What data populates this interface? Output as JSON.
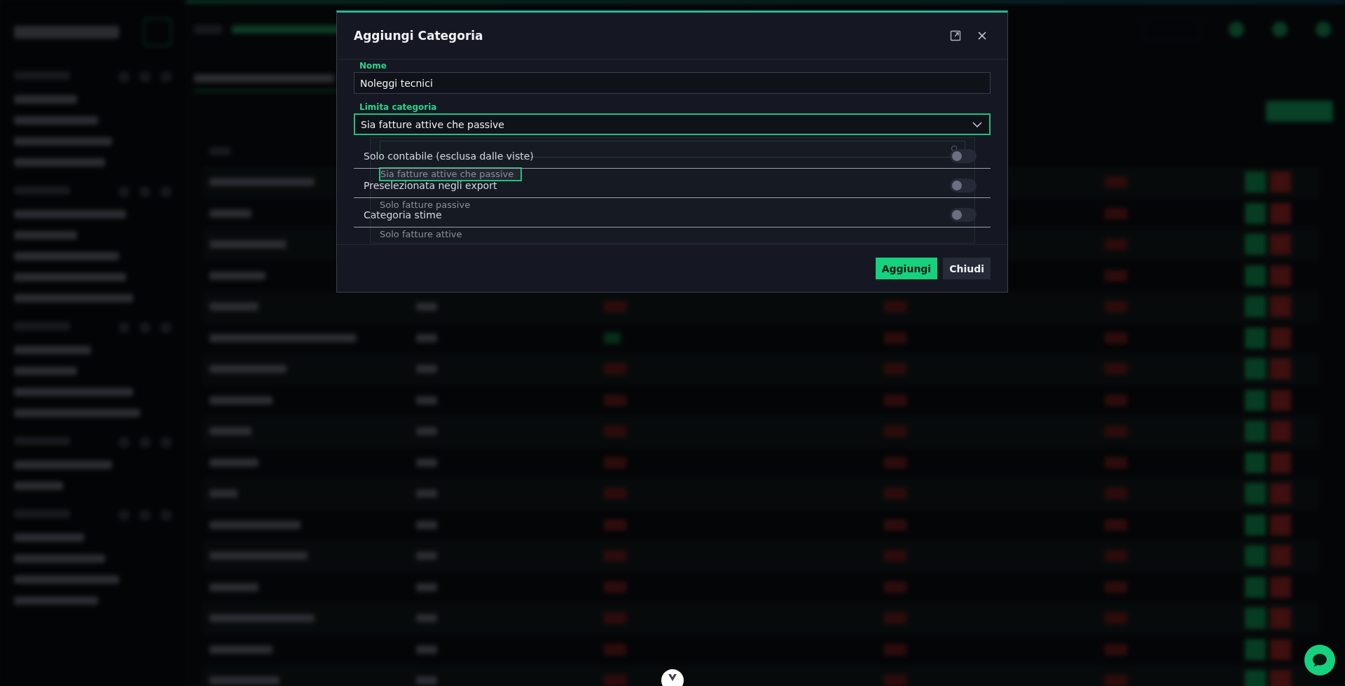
{
  "dialog": {
    "title": "Aggiungi Categoria",
    "fields": [
      {
        "kind": "text",
        "label": "Nome",
        "value": "Noleggi tecnici"
      },
      {
        "kind": "select",
        "label": "Limita categoria",
        "value": "Sia fatture attive che passive"
      }
    ],
    "dropdown_options": [
      {
        "label": "Sia fatture attive che passive",
        "selected": true
      },
      {
        "label": "Solo fatture passive",
        "selected": false
      },
      {
        "label": "Solo fatture attive",
        "selected": false
      }
    ],
    "toggles": [
      {
        "label": "Solo contabile (esclusa dalle viste)",
        "on": false
      },
      {
        "label": "Preselezionata negli export",
        "on": false
      },
      {
        "label": "Categoria stime",
        "on": false
      }
    ],
    "buttons": [
      {
        "kind": "primary",
        "label": "Aggiungi"
      },
      {
        "kind": "secondary",
        "label": "Chiudi"
      }
    ]
  }
}
